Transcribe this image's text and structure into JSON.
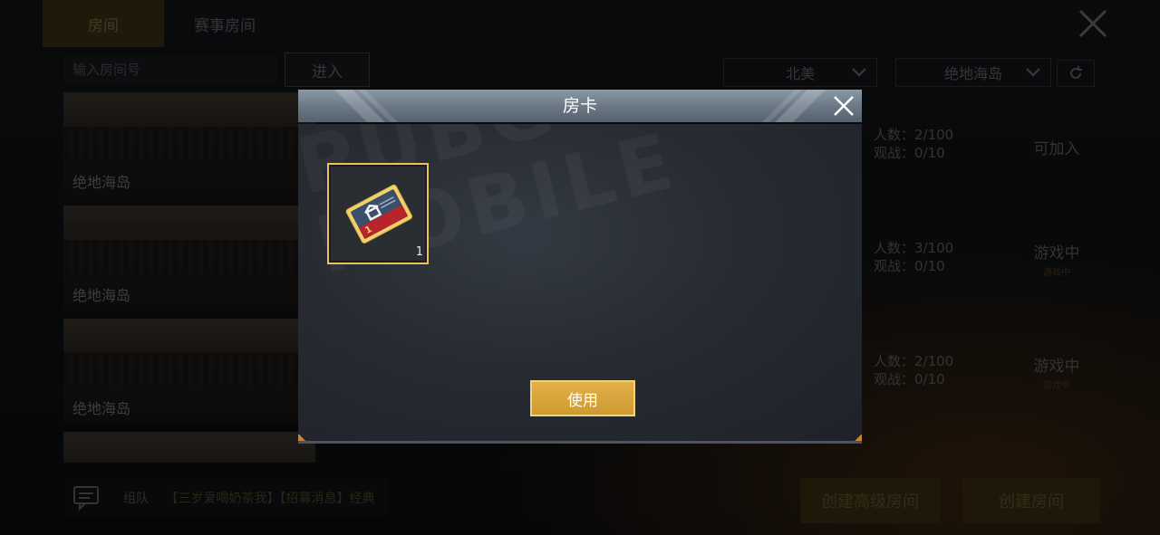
{
  "tabs": [
    {
      "label": "房间",
      "active": true
    },
    {
      "label": "赛事房间",
      "active": false
    }
  ],
  "search": {
    "placeholder": "输入房间号",
    "enter_label": "进入"
  },
  "filters": {
    "region": "北美",
    "map": "绝地海岛"
  },
  "rooms": [
    {
      "map_name": "绝地海岛",
      "players": "人数：2/100",
      "spectators": "观战：0/10",
      "status": "可加入",
      "status_sub": ""
    },
    {
      "map_name": "绝地海岛",
      "players": "人数：3/100",
      "spectators": "观战：0/10",
      "status": "游戏中",
      "status_sub": "游戏中"
    },
    {
      "map_name": "绝地海岛",
      "players": "人数：2/100",
      "spectators": "观战：0/10",
      "status": "游戏中",
      "status_sub": "游戏中"
    }
  ],
  "chat": {
    "team_label": "组队",
    "message": "【三岁爱喝奶茶我】【招募消息】经典"
  },
  "bottom_buttons": {
    "create_advanced": "创建高级房间",
    "create": "创建房间"
  },
  "modal": {
    "title": "房卡",
    "watermark": "PUBG MOBILE",
    "item": {
      "name": "room-card",
      "count": "1"
    },
    "use_label": "使用"
  },
  "colors": {
    "accent_gold": "#e7c455",
    "button_gold": "#d6a23a",
    "header_steel": "#7a8896"
  }
}
